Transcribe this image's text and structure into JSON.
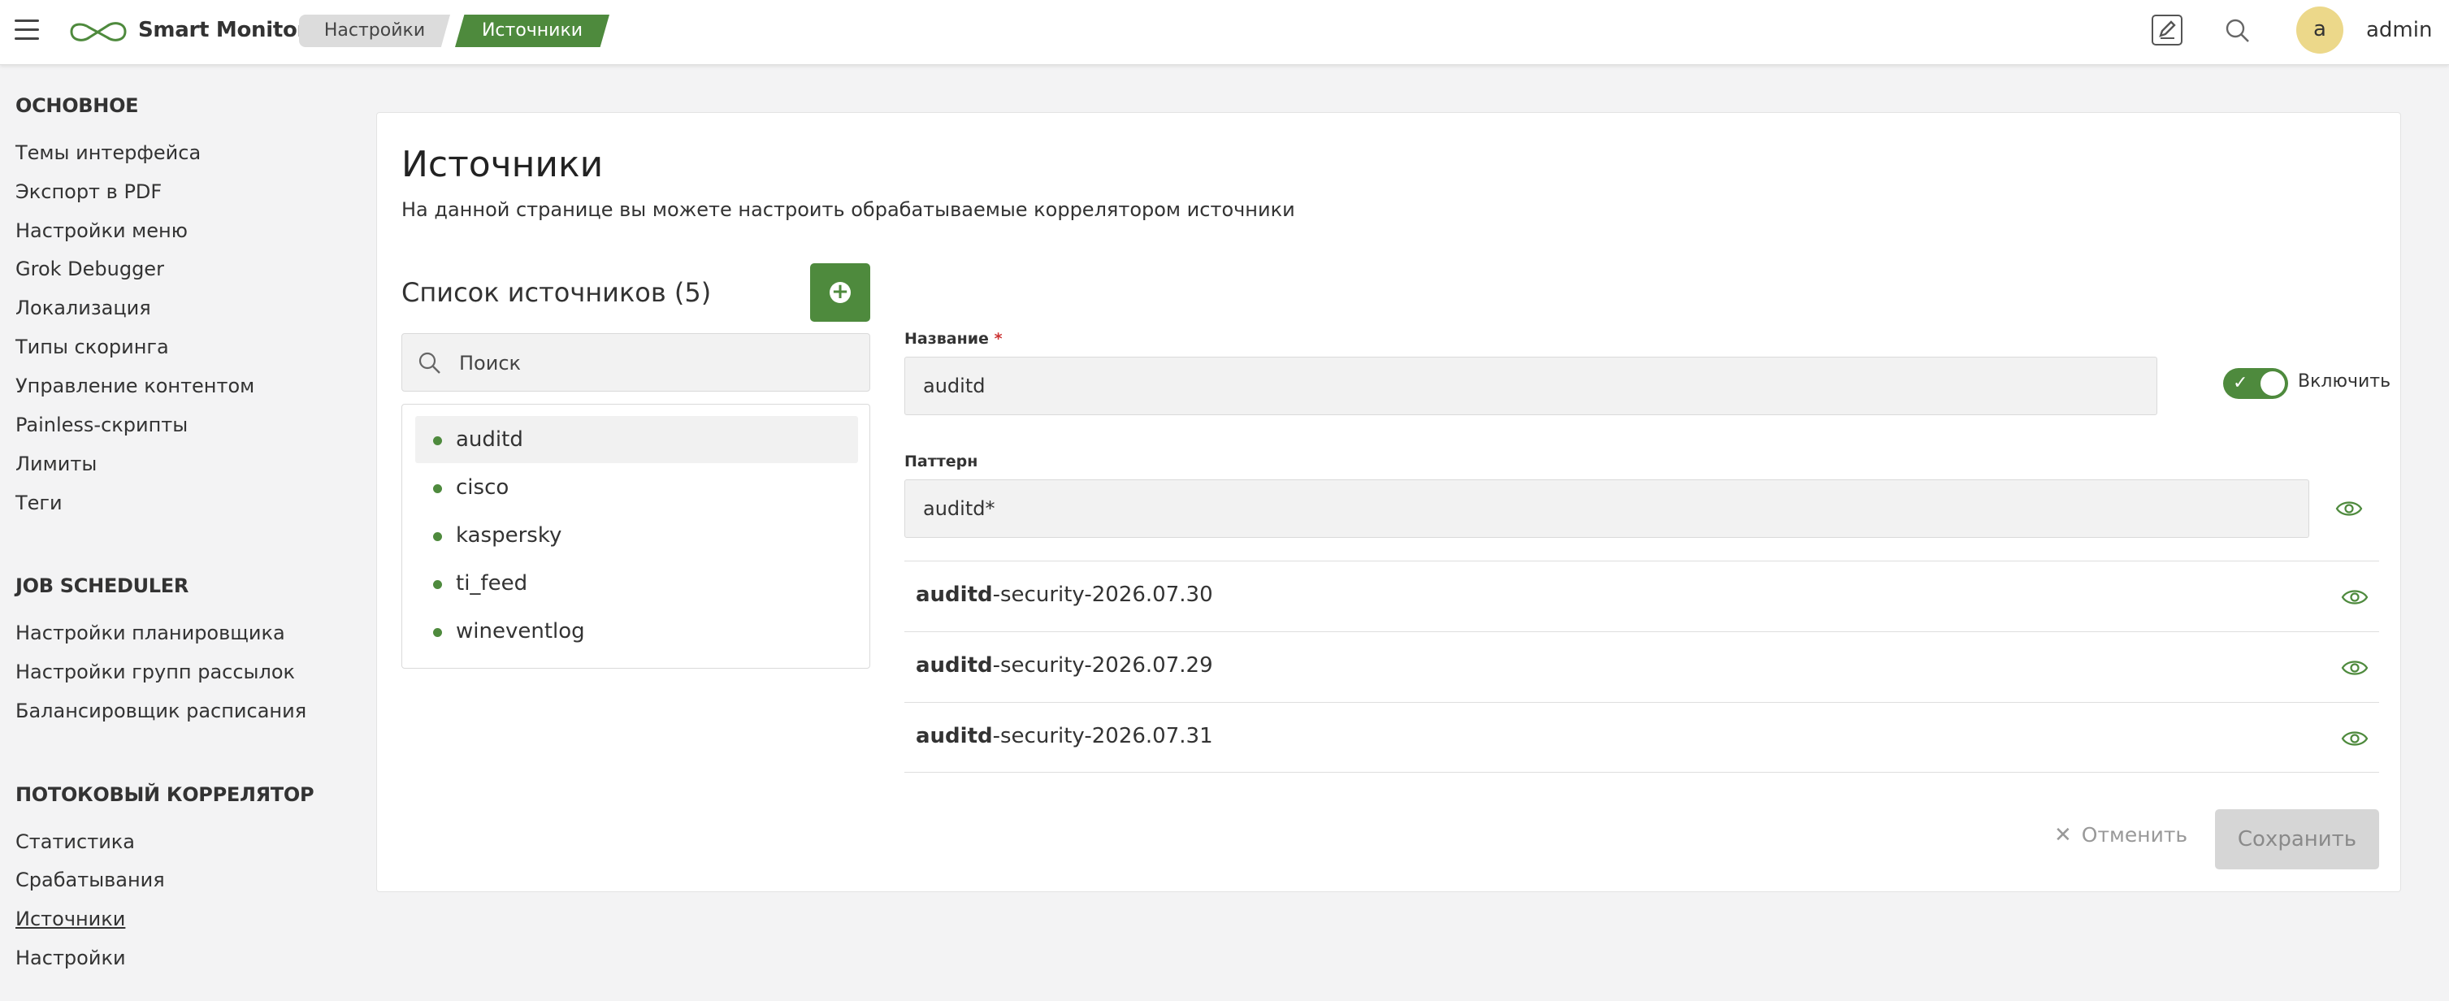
{
  "app": {
    "name": "Smart Monitor"
  },
  "breadcrumbs": [
    {
      "label": "Настройки"
    },
    {
      "label": "Источники"
    }
  ],
  "user": {
    "initial": "a",
    "name": "admin"
  },
  "sidebar": {
    "sections": [
      {
        "heading": "ОСНОВНОЕ",
        "items": [
          "Темы интерфейса",
          "Экспорт в PDF",
          "Настройки меню",
          "Grok Debugger",
          "Локализация",
          "Типы скоринга",
          "Управление контентом",
          "Painless-скрипты",
          "Лимиты",
          "Теги"
        ]
      },
      {
        "heading": "JOB SCHEDULER",
        "items": [
          "Настройки планировщика",
          "Настройки групп рассылок",
          "Балансировщик расписания"
        ]
      },
      {
        "heading": "ПОТОКОВЫЙ КОРРЕЛЯТОР",
        "items": [
          "Статистика",
          "Срабатывания",
          "Источники",
          "Настройки"
        ]
      }
    ],
    "active_item": "Источники"
  },
  "page": {
    "title": "Источники",
    "subtitle": "На данной странице вы можете настроить обрабатываемые коррелятором источники"
  },
  "sources": {
    "title": "Список источников (5)",
    "search_placeholder": "Поиск",
    "items": [
      "auditd",
      "cisco",
      "kaspersky",
      "ti_feed",
      "wineventlog"
    ],
    "selected": "auditd"
  },
  "form": {
    "name_label": "Название",
    "name_required_mark": "*",
    "name_value": "auditd",
    "enable_label": "Включить",
    "enabled": true,
    "pattern_label": "Паттерн",
    "pattern_value": "auditd*",
    "indices": [
      {
        "match": "auditd",
        "rest": "-security-2026.07.30"
      },
      {
        "match": "auditd",
        "rest": "-security-2026.07.29"
      },
      {
        "match": "auditd",
        "rest": "-security-2026.07.31"
      }
    ],
    "cancel_label": "Отменить",
    "save_label": "Сохранить"
  },
  "colors": {
    "accent": "#4e8a3d",
    "avatar": "#ecd88a",
    "background": "#f3f3f4"
  },
  "icons": [
    "menu-icon",
    "logo-icon",
    "edit-icon",
    "search-icon",
    "plus-icon",
    "check-icon",
    "eye-icon",
    "close-icon"
  ]
}
